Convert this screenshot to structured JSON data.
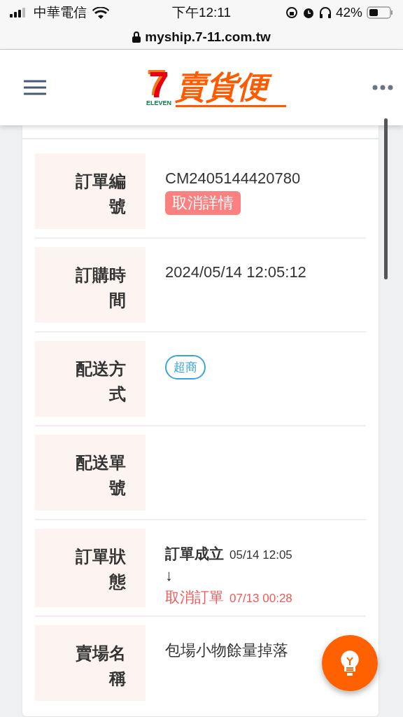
{
  "status_bar": {
    "carrier": "中華電信",
    "time": "下午12:11",
    "battery": "42%"
  },
  "address_bar": {
    "url": "myship.7-11.com.tw"
  },
  "header": {
    "logo_mark": "7",
    "logo_sub": "ELEVEN",
    "logo_name": "賣貨便"
  },
  "details": [
    {
      "label": "訂單編號",
      "kind": "order",
      "value": "CM2405144420780",
      "action": "取消詳情"
    },
    {
      "label": "訂購時間",
      "kind": "text",
      "value": "2024/05/14 12:05:12"
    },
    {
      "label": "配送方式",
      "kind": "tag",
      "value": "超商"
    },
    {
      "label": "配送單號",
      "kind": "empty"
    },
    {
      "label": "訂單狀態",
      "kind": "status",
      "arrow": "↓",
      "steps": [
        {
          "name": "訂單成立",
          "time": "05/14 12:05",
          "kind": "done"
        },
        {
          "name": "取消訂單",
          "time": "07/13 00:28",
          "kind": "cancelled"
        }
      ]
    },
    {
      "label": "賣場名稱",
      "kind": "text",
      "value": "包場小物餘量掉落"
    }
  ]
}
